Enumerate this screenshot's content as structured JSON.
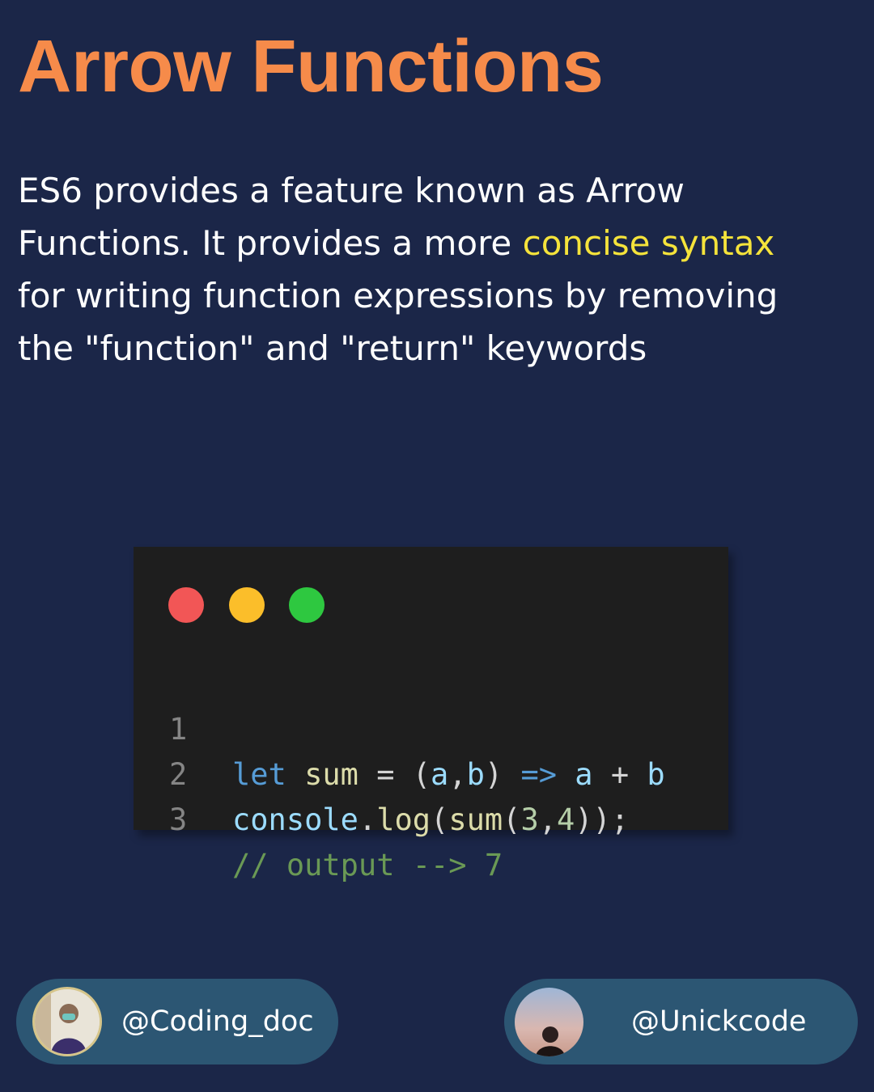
{
  "title": "Arrow Functions",
  "description": {
    "line1": "ES6 provides a feature known as Arrow",
    "line2_before": "Functions. It provides a more ",
    "line2_highlight": "concise syntax",
    "line3": "for writing function expressions by removing",
    "line4": "the \"function\" and \"return\" keywords"
  },
  "code_window": {
    "window_controls": [
      "close",
      "minimize",
      "maximize"
    ],
    "lines": [
      {
        "number": "1",
        "tokens": [
          {
            "t": "let",
            "c": "kw"
          },
          {
            "t": " ",
            "c": "txt"
          },
          {
            "t": "sum",
            "c": "var"
          },
          {
            "t": " = ",
            "c": "op"
          },
          {
            "t": "(",
            "c": "txt"
          },
          {
            "t": "a",
            "c": "param"
          },
          {
            "t": ",",
            "c": "txt"
          },
          {
            "t": "b",
            "c": "param"
          },
          {
            "t": ")",
            "c": "txt"
          },
          {
            "t": " ",
            "c": "txt"
          },
          {
            "t": "=>",
            "c": "arrow"
          },
          {
            "t": " ",
            "c": "txt"
          },
          {
            "t": "a",
            "c": "param"
          },
          {
            "t": " + ",
            "c": "op"
          },
          {
            "t": "b",
            "c": "param"
          }
        ]
      },
      {
        "number": "2",
        "tokens": [
          {
            "t": "console",
            "c": "param"
          },
          {
            "t": ".",
            "c": "txt"
          },
          {
            "t": "log",
            "c": "var"
          },
          {
            "t": "(",
            "c": "txt"
          },
          {
            "t": "sum",
            "c": "var"
          },
          {
            "t": "(",
            "c": "txt"
          },
          {
            "t": "3",
            "c": "num"
          },
          {
            "t": ",",
            "c": "txt"
          },
          {
            "t": "4",
            "c": "num"
          },
          {
            "t": "));",
            "c": "txt"
          }
        ]
      },
      {
        "number": "3",
        "tokens": [
          {
            "t": "// output --> ",
            "c": "cmt"
          },
          {
            "t": "7",
            "c": "cmt"
          }
        ]
      }
    ]
  },
  "footer": {
    "left_handle": "@Coding_doc",
    "right_handle": "@Unickcode"
  },
  "colors": {
    "background": "#1b2648",
    "title": "#f68b4a",
    "highlight": "#f5e33b",
    "pill": "#2c5673",
    "code_bg": "#1e1e1e"
  }
}
